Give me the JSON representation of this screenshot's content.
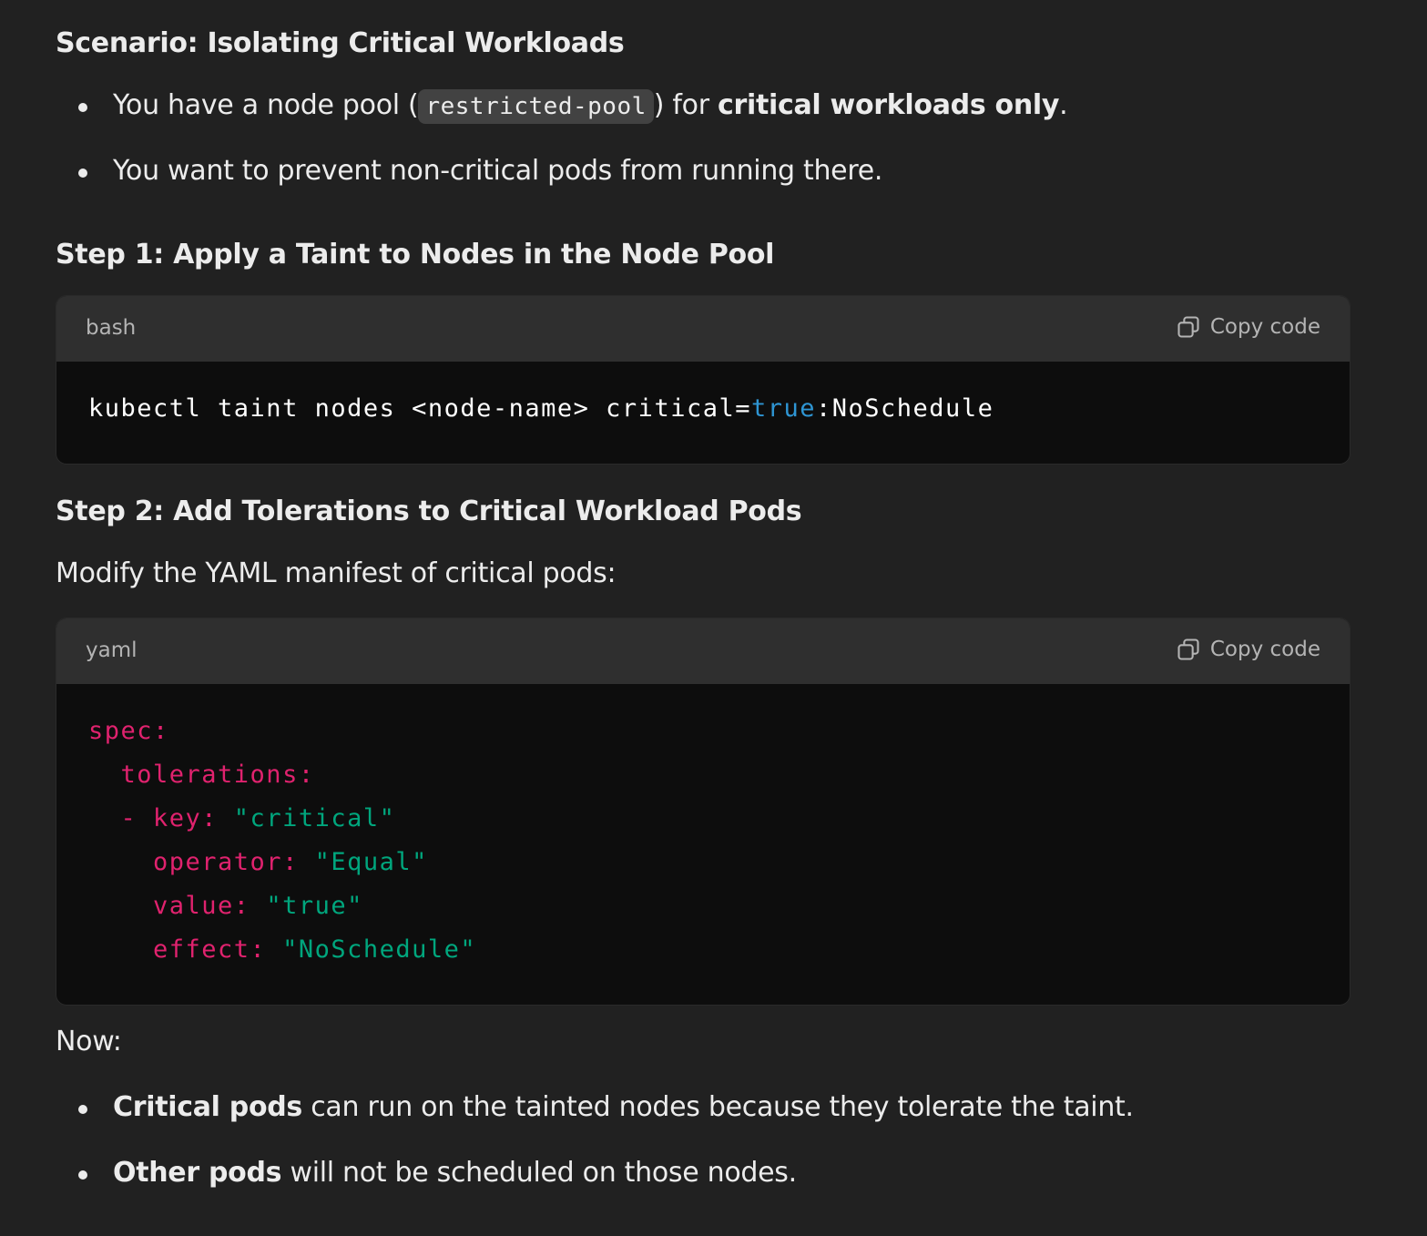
{
  "scenario_heading": "Scenario: Isolating Critical Workloads",
  "scenario_bullets": {
    "b1_pre": "You have a node pool (",
    "b1_code": "restricted-pool",
    "b1_mid": ") for ",
    "b1_strong": "critical workloads only",
    "b1_post": ".",
    "b2": "You want to prevent non-critical pods from running there."
  },
  "step1_heading": "Step 1: Apply a Taint to Nodes in the Node Pool",
  "code_block_1": {
    "language": "bash",
    "copy_label": "Copy code",
    "line_pre": "kubectl taint nodes <node-name> critical=",
    "line_kw": "true",
    "line_post": ":NoSchedule"
  },
  "step2_heading": "Step 2: Add Tolerations to Critical Workload Pods",
  "step2_intro": "Modify the YAML manifest of critical pods:",
  "code_block_2": {
    "language": "yaml",
    "copy_label": "Copy code",
    "lines": {
      "l1_key": "spec:",
      "l2_key": "  tolerations:",
      "l3_key": "  - key:",
      "l3_val": " \"critical\"",
      "l4_key": "    operator:",
      "l4_val": " \"Equal\"",
      "l5_key": "    value:",
      "l5_val": " \"true\"",
      "l6_key": "    effect:",
      "l6_val": " \"NoSchedule\""
    }
  },
  "now_label": "Now:",
  "now_bullets": {
    "b1_strong": "Critical pods",
    "b1_rest": " can run on the tainted nodes because they tolerate the taint.",
    "b2_strong": "Other pods",
    "b2_rest": " will not be scheduled on those nodes."
  },
  "colors": {
    "background": "#212121",
    "code_background": "#0d0d0d",
    "code_header": "#2f2f2f",
    "yaml_key": "#e0226e",
    "yaml_string": "#00a67d",
    "bash_keyword": "#2e95d3"
  }
}
